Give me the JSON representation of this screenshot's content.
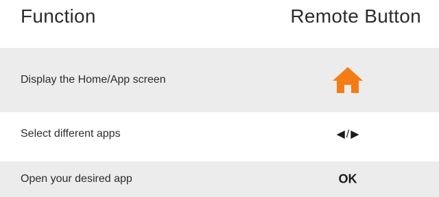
{
  "header": {
    "function_label": "Function",
    "button_label": "Remote Button"
  },
  "rows": [
    {
      "function": "Display the Home/App screen",
      "button_icon": "home-icon"
    },
    {
      "function": "Select different apps",
      "button_left": "◀",
      "button_sep": "/",
      "button_right": "▶"
    },
    {
      "function": "Open your desired app",
      "button": "OK"
    }
  ],
  "colors": {
    "row_shading": "#ececec",
    "home_icon": "#f57c14",
    "text": "#2b2b2b"
  }
}
